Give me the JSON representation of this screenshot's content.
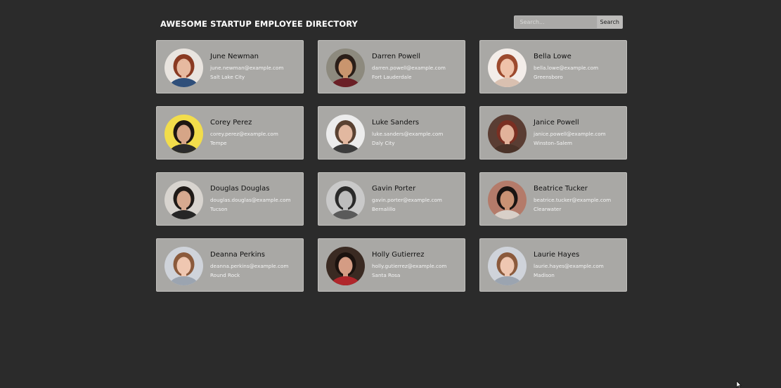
{
  "header": {
    "title": "AWESOME STARTUP EMPLOYEE DIRECTORY",
    "search_placeholder": "Search...",
    "search_button": "Search"
  },
  "employees": [
    {
      "name": "June Newman",
      "email": "june.newman@example.com",
      "city": "Salt Lake City",
      "bg": "#e9e4df",
      "hair": "#8a3a22",
      "skin": "#e6b9a0",
      "shirt": "#2f4f7a"
    },
    {
      "name": "Darren Powell",
      "email": "darren.powell@example.com",
      "city": "Fort Lauderdale",
      "bg": "#8d8a7e",
      "hair": "#2a1e18",
      "skin": "#c9956e",
      "shirt": "#6a1f26"
    },
    {
      "name": "Bella Lowe",
      "email": "bella.lowe@example.com",
      "city": "Greensboro",
      "bg": "#f3ede9",
      "hair": "#9c4a2e",
      "skin": "#efc2a9",
      "shirt": "#d9c0b0"
    },
    {
      "name": "Corey Perez",
      "email": "corey.perez@example.com",
      "city": "Tempe",
      "bg": "#f2dd4b",
      "hair": "#1c1612",
      "skin": "#d6a587",
      "shirt": "#2b2b2b"
    },
    {
      "name": "Luke Sanders",
      "email": "luke.sanders@example.com",
      "city": "Daly City",
      "bg": "#ececec",
      "hair": "#5a4232",
      "skin": "#e2b8a0",
      "shirt": "#3b3b3b"
    },
    {
      "name": "Janice Powell",
      "email": "janice.powell@example.com",
      "city": "Winston–Salem",
      "bg": "#5a3d33",
      "hair": "#7a2f22",
      "skin": "#e2b29a",
      "shirt": "#4a3228"
    },
    {
      "name": "Douglas Douglas",
      "email": "douglas.douglas@example.com",
      "city": "Tucson",
      "bg": "#d8d4cf",
      "hair": "#1f1a17",
      "skin": "#d7aa90",
      "shirt": "#262626"
    },
    {
      "name": "Gavin Porter",
      "email": "gavin.porter@example.com",
      "city": "Bernalillo",
      "bg": "#c9c9c9",
      "hair": "#2a2a2a",
      "skin": "#bdbdbd",
      "shirt": "#5a5a5a"
    },
    {
      "name": "Beatrice Tucker",
      "email": "beatrice.tucker@example.com",
      "city": "Clearwater",
      "bg": "#b47b6a",
      "hair": "#1a1412",
      "skin": "#c99274",
      "shirt": "#d8cfc8"
    },
    {
      "name": "Deanna Perkins",
      "email": "deanna.perkins@example.com",
      "city": "Round Rock",
      "bg": "#cfd3da",
      "hair": "#8b5a3c",
      "skin": "#efc7b1",
      "shirt": "#9ba4b0"
    },
    {
      "name": "Holly Gutierrez",
      "email": "holly.gutierrez@example.com",
      "city": "Santa Rosa",
      "bg": "#3a2a22",
      "hair": "#1b120e",
      "skin": "#d49c84",
      "shirt": "#b0262b"
    },
    {
      "name": "Laurie Hayes",
      "email": "laurie.hayes@example.com",
      "city": "Madison",
      "bg": "#cfd3da",
      "hair": "#8b5a3c",
      "skin": "#efc7b1",
      "shirt": "#9ba4b0"
    }
  ]
}
